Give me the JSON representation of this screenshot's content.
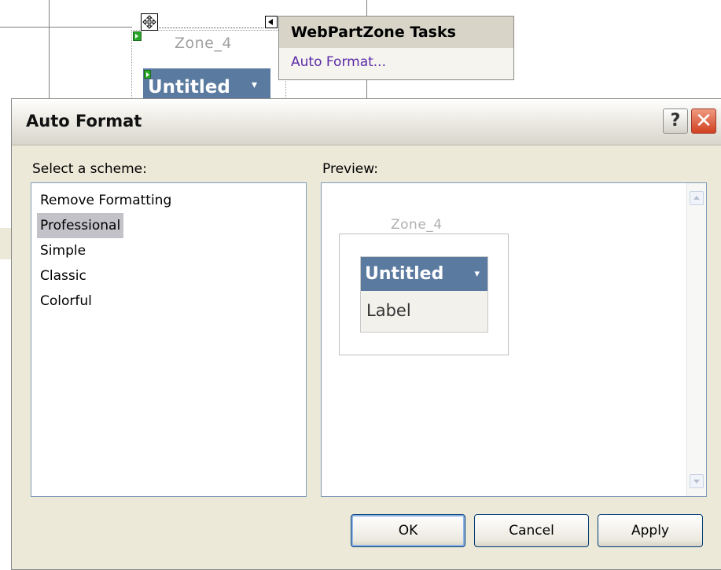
{
  "designer": {
    "zone_title": "Zone_4",
    "part_title": "Untitled",
    "verb_glyph": "▾",
    "move_icon": "move-arrows-icon",
    "smart_tag": {
      "header": "WebPartZone Tasks",
      "link": "Auto Format..."
    }
  },
  "dialog": {
    "title": "Auto Format",
    "help_label": "?",
    "close_label": "✕",
    "scheme_label": "Select a scheme:",
    "preview_label": "Preview:",
    "schemes": [
      "Remove Formatting",
      "Professional",
      "Simple",
      "Classic",
      "Colorful"
    ],
    "selected_scheme": "Professional",
    "preview": {
      "zone_title": "Zone_4",
      "part_title": "Untitled",
      "verb_glyph": "▾",
      "content": "Label"
    },
    "buttons": {
      "ok": "OK",
      "cancel": "Cancel",
      "apply": "Apply"
    }
  },
  "colors": {
    "dialog_bg": "#ece9d8",
    "part_title_bg": "#5b7aa0",
    "link": "#5b2aa8",
    "selection": "#c2c2c8",
    "close": "#d04020"
  }
}
